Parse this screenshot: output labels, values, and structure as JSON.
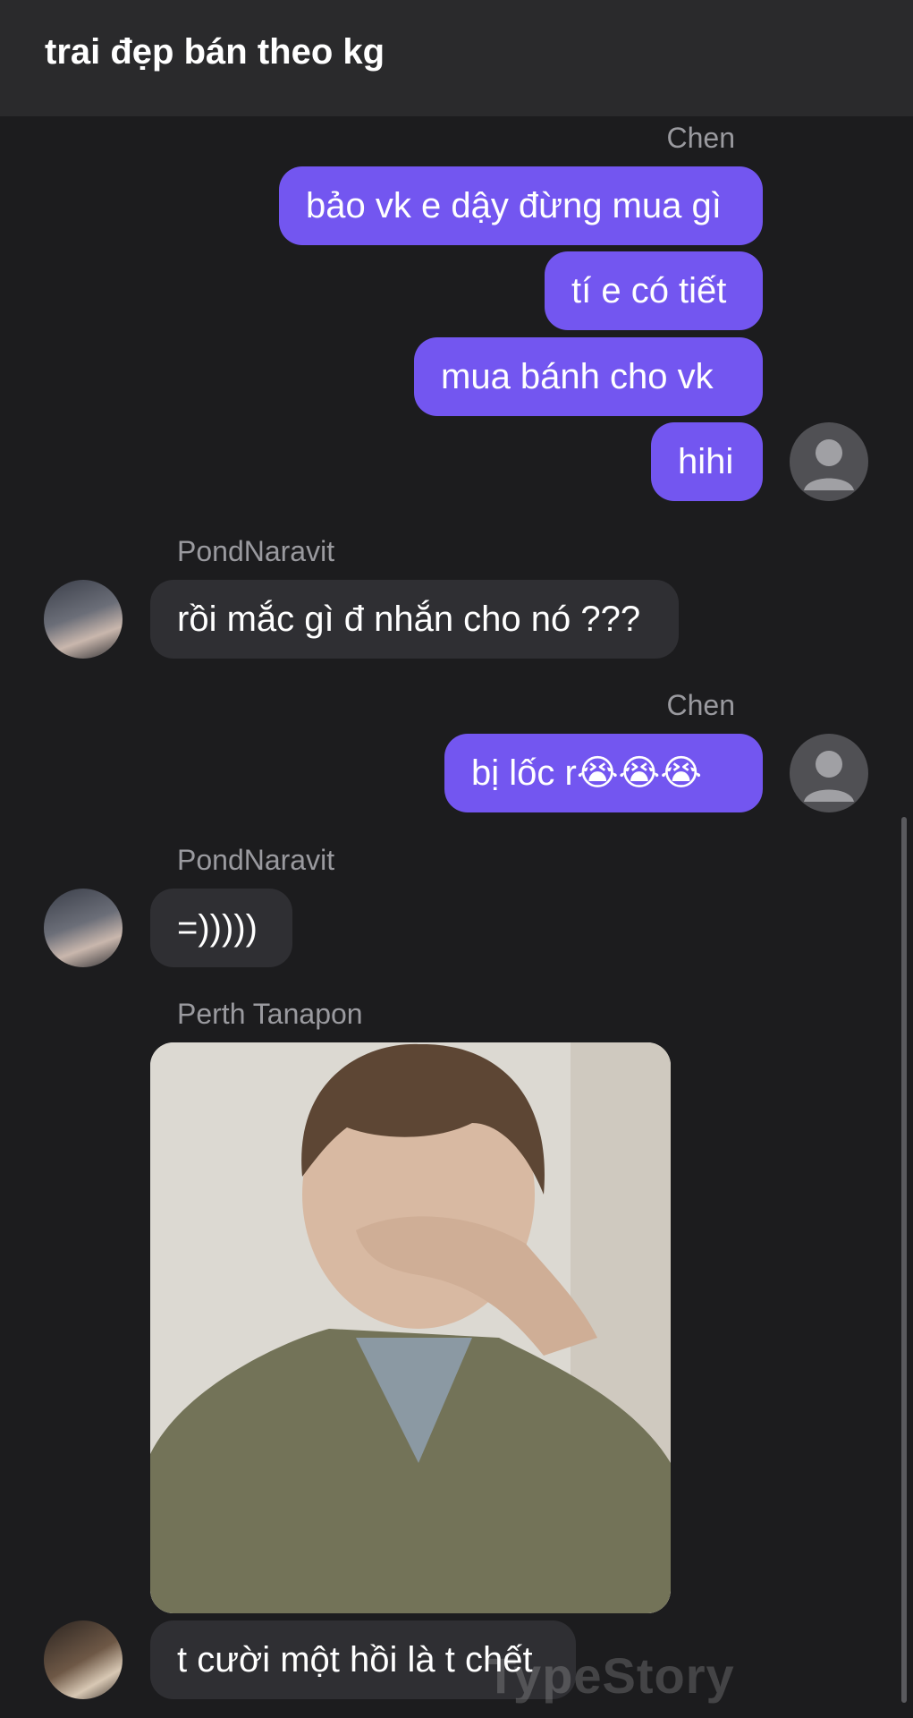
{
  "header": {
    "title": "trai đẹp bán theo kg"
  },
  "messages": {
    "m1": {
      "sender": "Chen",
      "texts": [
        "bảo vk e dậy đừng mua gì",
        "tí e có tiết",
        "mua bánh cho vk",
        "hihi"
      ]
    },
    "m2": {
      "sender": "PondNaravit",
      "text": "rồi mắc gì đ nhắn cho nó ???"
    },
    "m3": {
      "sender": "Chen",
      "text": "bị lốc r😭😭😭"
    },
    "m4": {
      "sender": "PondNaravit",
      "text": "=)))))"
    },
    "m5": {
      "sender": "Perth Tanapon",
      "text": "t cười một hồi là t chết"
    }
  },
  "watermark": "TypeStory",
  "colors": {
    "outgoing": "#7356f0",
    "incoming": "#2f2f33",
    "background": "#1c1c1e"
  }
}
